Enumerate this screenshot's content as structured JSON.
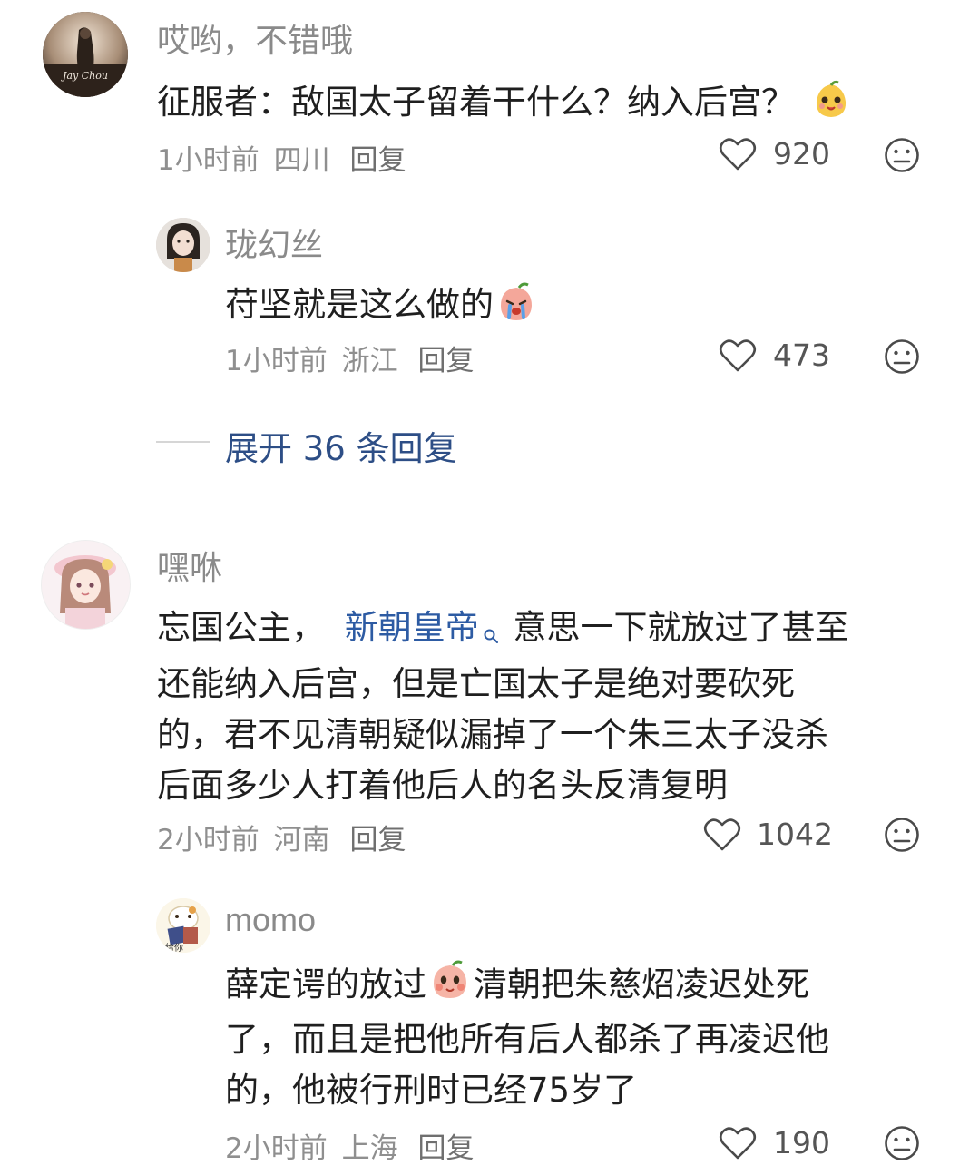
{
  "comments": [
    {
      "username": "哎哟，不错哦",
      "avatar_caption": "Jay Chou",
      "text": "征服者：敌国太子留着干什么？纳入后宫？",
      "time": "1小时前",
      "location": "四川",
      "reply_label": "回复",
      "likes": "920",
      "emoji_icon": "pear-face-emoji-icon"
    },
    {
      "username": "珑幻丝",
      "text": "苻坚就是这么做的",
      "time": "1小时前",
      "location": "浙江",
      "reply_label": "回复",
      "likes": "473",
      "emoji_icon": "crying-peach-emoji-icon"
    },
    {
      "username": "嘿咻",
      "text_before": "忘国公主，",
      "link_text": "新朝皇帝",
      "lines": [
        "意思一下就放过了甚至",
        "还能纳入后宫，但是亡国太子是绝对要砍死",
        "的，君不见清朝疑似漏掉了一个朱三太子没杀",
        "后面多少人打着他后人的名头反清复明"
      ],
      "time": "2小时前",
      "location": "河南",
      "reply_label": "回复",
      "likes": "1042"
    },
    {
      "username": "momo",
      "avatar_caption": "给你",
      "text_before": "薛定谔的放过",
      "lines": [
        "清朝把朱慈炤凌迟处死",
        "了，而且是把他所有后人都杀了再凌迟他",
        "的，他被行刑时已经75岁了"
      ],
      "time": "2小时前",
      "location": "上海",
      "reply_label": "回复",
      "likes": "190",
      "emoji_icon": "blushing-peach-emoji-icon"
    }
  ],
  "expand_replies": "展开 36 条回复",
  "icons": {
    "like": "heart-outline-icon",
    "dislike": "unhappy-face-icon",
    "search": "magnifier-icon"
  },
  "colors": {
    "link": "#2d5ba3",
    "expand": "#2d4e86",
    "meta": "#8f8f8f"
  }
}
